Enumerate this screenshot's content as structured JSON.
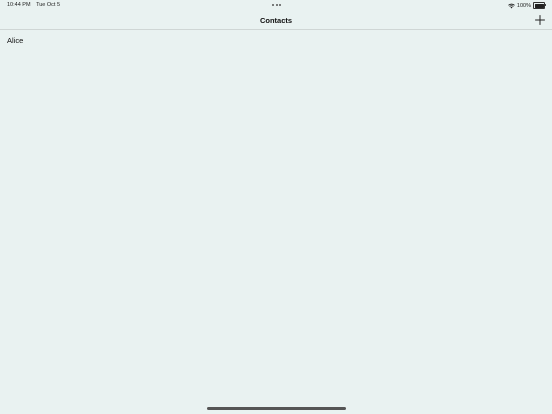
{
  "status_bar": {
    "time": "10:44 PM",
    "date": "Tue Oct 5",
    "battery": "100%"
  },
  "nav": {
    "title": "Contacts",
    "add_icon": "plus-icon"
  },
  "contacts": [
    {
      "name": "Alice"
    }
  ],
  "colors": {
    "background": "#e9f2f1",
    "text": "#111111"
  }
}
